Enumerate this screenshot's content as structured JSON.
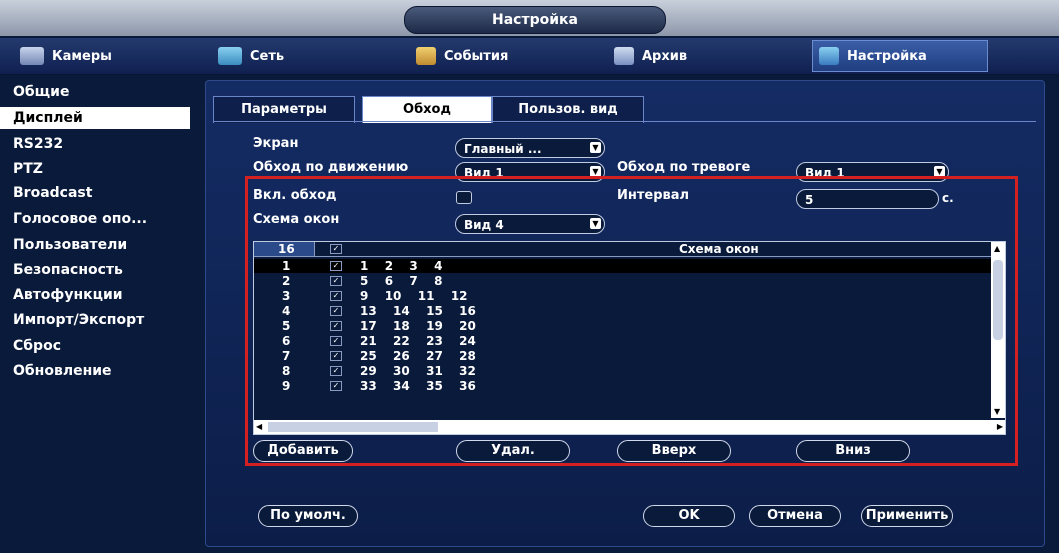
{
  "title": "Настройка",
  "nav": [
    {
      "label": "Камеры",
      "icon": "camera-icon"
    },
    {
      "label": "Сеть",
      "icon": "network-icon"
    },
    {
      "label": "События",
      "icon": "events-icon"
    },
    {
      "label": "Архив",
      "icon": "archive-icon"
    },
    {
      "label": "Настройка",
      "icon": "settings-icon",
      "active": true
    }
  ],
  "sidebar": [
    {
      "label": "Общие"
    },
    {
      "label": "Дисплей",
      "active": true
    },
    {
      "label": "RS232"
    },
    {
      "label": "PTZ"
    },
    {
      "label": "Broadcast"
    },
    {
      "label": "Голосовое опо..."
    },
    {
      "label": "Пользователи"
    },
    {
      "label": "Безопасность"
    },
    {
      "label": "Автофункции"
    },
    {
      "label": "Импорт/Экспорт"
    },
    {
      "label": "Сброс"
    },
    {
      "label": "Обновление"
    }
  ],
  "subtabs": [
    {
      "label": "Параметры"
    },
    {
      "label": "Обход",
      "active": true
    },
    {
      "label": "Пользов. вид"
    }
  ],
  "form": {
    "screen_label": "Экран",
    "screen_value": "Главный ...",
    "motion_tour_label": "Обход по движению",
    "motion_tour_value": "Вид 1",
    "alarm_tour_label": "Обход по тревоге",
    "alarm_tour_value": "Вид 1",
    "enable_tour_label": "Вкл. обход",
    "enable_tour_checked": false,
    "interval_label": "Интервал",
    "interval_value": "5",
    "interval_unit": "с.",
    "layout_label": "Схема окон",
    "layout_value": "Вид 4"
  },
  "grid": {
    "header_count": "16",
    "header_title": "Схема окон",
    "rows": [
      {
        "num": "1",
        "cells": "1  2  3  4",
        "checked": true
      },
      {
        "num": "2",
        "cells": "5  6  7  8",
        "checked": true
      },
      {
        "num": "3",
        "cells": "9  10  11  12",
        "checked": true
      },
      {
        "num": "4",
        "cells": "13  14  15  16",
        "checked": true
      },
      {
        "num": "5",
        "cells": "17  18  19  20",
        "checked": true
      },
      {
        "num": "6",
        "cells": "21  22  23  24",
        "checked": true
      },
      {
        "num": "7",
        "cells": "25  26  27  28",
        "checked": true
      },
      {
        "num": "8",
        "cells": "29  30  31  32",
        "checked": true
      },
      {
        "num": "9",
        "cells": "33  34  35  36",
        "checked": true
      }
    ]
  },
  "buttons": {
    "add": "Добавить",
    "delete": "Удал.",
    "up": "Вверх",
    "down": "Вниз",
    "default": "По умолч.",
    "ok": "OK",
    "cancel": "Отмена",
    "apply": "Применить"
  }
}
